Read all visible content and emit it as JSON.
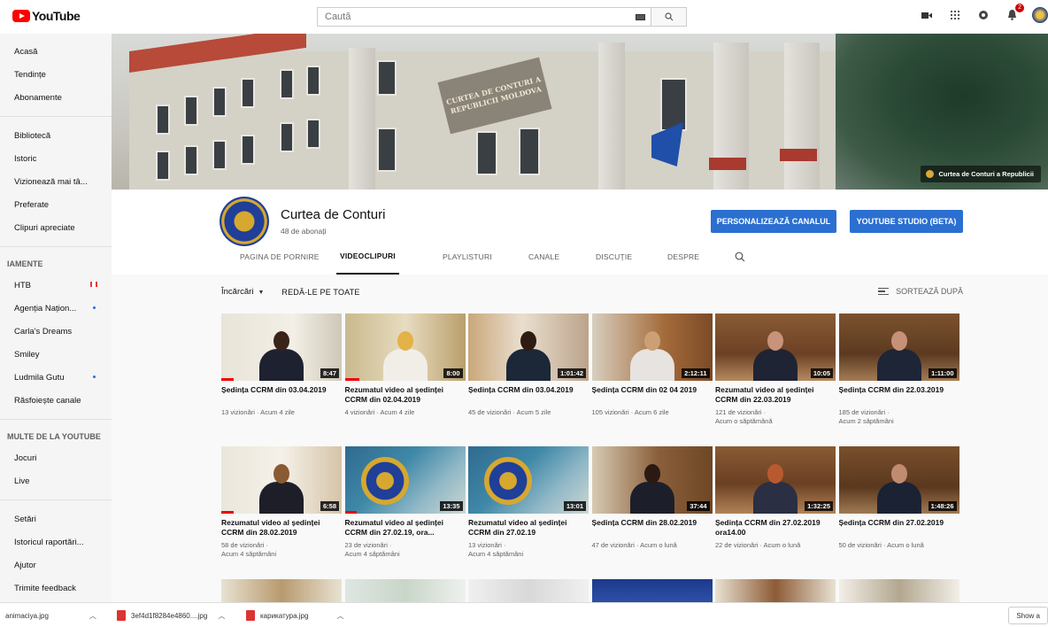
{
  "topbar": {
    "logo_text": "YouTube",
    "search_placeholder": "Caută",
    "notification_count": "2"
  },
  "sidebar": {
    "main": [
      "Acasă",
      "Tendințe",
      "Abonamente"
    ],
    "library": [
      "Bibliotecă",
      "Istoric",
      "Vizionează mai tâ...",
      "Preferate",
      "Clipuri apreciate"
    ],
    "subs_header": "IAMENTE",
    "subs": [
      {
        "label": "HTB",
        "marker": "flag"
      },
      {
        "label": "Agenția Națion...",
        "marker": "dot"
      },
      {
        "label": "Carla's Dreams",
        "marker": ""
      },
      {
        "label": "Smiley",
        "marker": ""
      },
      {
        "label": "Ludmila Gutu",
        "marker": "dot"
      },
      {
        "label": "Răsfoiește canale",
        "marker": ""
      }
    ],
    "more_header": "MULTE DE LA YOUTUBE",
    "more": [
      "Jocuri",
      "Live"
    ],
    "settings": [
      "Setări",
      "Istoricul raportări...",
      "Ajutor",
      "Trimite feedback"
    ]
  },
  "banner": {
    "plaque_text": "CURTEA DE CONTURI A REPUBLICII MOLDOVA",
    "channel_link": "Curtea de Conturi a Republicii"
  },
  "channel": {
    "name": "Curtea de Conturi",
    "subscribers": "48 de abonați",
    "customize_button": "PERSONALIZEAZĂ CANALUL",
    "studio_button": "YOUTUBE STUDIO (BETA)"
  },
  "tabs": [
    "PAGINA DE PORNIRE",
    "VIDEOCLIPURI",
    "PLAYLISTURI",
    "CANALE",
    "DISCUȚIE",
    "DESPRE"
  ],
  "toolbar": {
    "uploads": "Încărcări",
    "play_all": "REDĂ-LE PE TOATE",
    "sort": "SORTEAZĂ DUPĂ"
  },
  "videos": [
    {
      "title": "Ședința CCRM din 03.04.2019",
      "duration": "8:47",
      "meta1": "13 vizionări · Acum 4 zile",
      "meta2": "",
      "progress": 0.1,
      "kind": "woman-dark"
    },
    {
      "title": "Rezumatul video al ședinței CCRM din 02.04.2019",
      "duration": "8:00",
      "meta1": "4 vizionări · Acum 4 zile",
      "meta2": "",
      "progress": 0.12,
      "kind": "woman-blond"
    },
    {
      "title": "Ședința CCRM din 03.04.2019",
      "duration": "1:01:42",
      "meta1": "45 de vizionări · Acum 5 zile",
      "meta2": "",
      "progress": 0.0,
      "kind": "woman-dark2"
    },
    {
      "title": "Ședința CCRM din 02 04 2019",
      "duration": "2:12:11",
      "meta1": "105 vizionări · Acum 6 zile",
      "meta2": "",
      "progress": 0.0,
      "kind": "woman-blond2"
    },
    {
      "title": "Rezumatul video al ședinței CCRM din 22.03.2019",
      "duration": "10:05",
      "meta1": "121 de vizionări ·",
      "meta2": "Acum o săptămână",
      "progress": 0.0,
      "kind": "man-desk"
    },
    {
      "title": "Ședința CCRM din 22.03.2019",
      "duration": "1:11:00",
      "meta1": "185 de vizionări ·",
      "meta2": "Acum 2 săptămâni",
      "progress": 0.0,
      "kind": "man-desk2"
    },
    {
      "title": "Rezumatul video al ședinței CCRM din 28.02.2019",
      "duration": "6:58",
      "meta1": "58 de vizionări ·",
      "meta2": "Acum 4 săptămâni",
      "progress": 0.1,
      "kind": "woman-podium"
    },
    {
      "title": "Rezumatul video al ședinței CCRM din 27.02.19, ora...",
      "duration": "13:35",
      "meta1": "23 de vizionări ·",
      "meta2": "Acum 4 săptămâni",
      "progress": 0.1,
      "kind": "emblem"
    },
    {
      "title": "Rezumatul video al ședinței CCRM din 27.02.19",
      "duration": "13:01",
      "meta1": "13 vizionări ·",
      "meta2": "Acum 4 săptămâni",
      "progress": 0.0,
      "kind": "emblem"
    },
    {
      "title": "Ședința CCRM din 28.02.2019",
      "duration": "37:44",
      "meta1": "47 de vizionări · Acum o lună",
      "meta2": "",
      "progress": 0.0,
      "kind": "woman-dark3"
    },
    {
      "title": "Ședința CCRM din 27.02.2019 ora14.00",
      "duration": "1:32:25",
      "meta1": "22 de vizionări · Acum o lună",
      "meta2": "",
      "progress": 0.0,
      "kind": "woman-red"
    },
    {
      "title": "Ședința CCRM din 27.02.2019",
      "duration": "1:48:26",
      "meta1": "50 de vizionări · Acum o lună",
      "meta2": "",
      "progress": 0.0,
      "kind": "man-desk3"
    }
  ],
  "downloads": [
    {
      "name": "animaciya.jpg"
    },
    {
      "name": "3ef4d1f8284e4860....jpg"
    },
    {
      "name": "карикатура.jpg"
    }
  ],
  "downloads_show_all": "Show a"
}
